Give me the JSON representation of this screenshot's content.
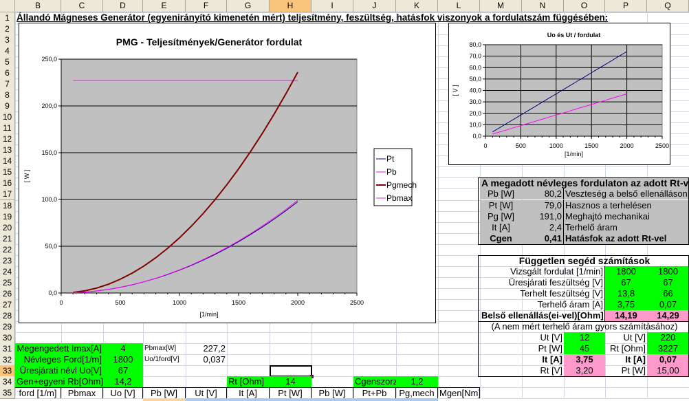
{
  "sheet": {
    "columns": [
      "B",
      "C",
      "D",
      "E",
      "F",
      "G",
      "H",
      "I",
      "J",
      "K",
      "L",
      "M",
      "N",
      "O",
      "P",
      "Q"
    ],
    "rows": [
      "1",
      "2",
      "3",
      "4",
      "5",
      "6",
      "7",
      "8",
      "9",
      "10",
      "11",
      "12",
      "13",
      "14",
      "15",
      "16",
      "17",
      "18",
      "19",
      "20",
      "21",
      "22",
      "23",
      "24",
      "25",
      "26",
      "27",
      "28",
      "29",
      "30",
      "31",
      "32",
      "33",
      "34",
      "35"
    ],
    "selected_column": "H",
    "selected_row": "33",
    "title": "Állandó Mágneses Generátor (egyenirányító kimenetén mért) teljesítmény, feszültség, hatásfok viszonyok a fordulatszám függésében:"
  },
  "colors": {
    "green": "#00ff00",
    "pink": "#ff99cc",
    "gray": "#c0c0c0",
    "plot_bg": "#c0c0c0",
    "selection": "#f9c47c"
  },
  "inputs": {
    "imax_label": "Megengedett Imax[A]",
    "imax": "4",
    "nevl_ford_label": "Névleges Ford[1/m]",
    "nevl_ford": "1800",
    "uo_label": "Üresjárati névl Uo[V]",
    "uo": "67",
    "rb_label": "Gen+egyeni Rb[Ohm]",
    "rb": "14,2",
    "pbmax_label": "Pbmax[W]",
    "pbmax": "227,2",
    "uo1_label": "Uo/1ford[V]",
    "uo1": "0,037",
    "rt_label": "Rt [Ohm]",
    "rt": "14",
    "cgen_label": "Cgenszorz",
    "cgen": "1,2"
  },
  "table_headers": [
    "ford [1/m]",
    "Pbmax",
    "Uo [V]",
    "Pb [W]",
    "Ut [V]",
    "It [A]",
    "Pt [W]",
    "Pb [W]",
    "Pt+Pb",
    "Pg,mech",
    "Mgen[Nm]"
  ],
  "summary": {
    "title": "A megadott névleges fordulaton az adott Rt-vel",
    "rows": [
      {
        "label": "Pb [W]",
        "value": "80,2",
        "desc": "Veszteség a belső ellenálláson"
      },
      {
        "label": "Pt [W]",
        "value": "79,0",
        "desc": "Hasznos a terhelésen"
      },
      {
        "label": "Pg [W]",
        "value": "191,0",
        "desc": "Meghajtó mechanikai"
      },
      {
        "label": "It [A]",
        "value": "2,4",
        "desc": "Terhelő áram"
      },
      {
        "label": "Cgen",
        "value": "0,41",
        "desc": "Hatásfok az adott Rt-vel"
      }
    ]
  },
  "aux": {
    "title": "Független segéd számítások",
    "rows": [
      {
        "label": "Vizsgált fordulat [1/min]",
        "v1": "1800",
        "v2": "1800"
      },
      {
        "label": "Üresjárati feszültség [V]",
        "v1": "67",
        "v2": "67"
      },
      {
        "label": "Terhelt feszültség [V]",
        "v1": "13,8",
        "v2": "66"
      },
      {
        "label": "Terhelő áram [A]",
        "v1": "3,75",
        "v2": "0,07"
      },
      {
        "label": "Belső ellenállás(ei-vel)[Ohm]",
        "v1": "14,19",
        "v2": "14,29"
      }
    ]
  },
  "quick": {
    "title": "(A nem mért terhelő áram gyors számításához)",
    "rows": [
      {
        "l1": "Ut [V]",
        "v1": "12",
        "l2": "Ut [V]",
        "v2": "220"
      },
      {
        "l1": "Pt [W]",
        "v1": "45",
        "l2": "Rt [Ohm]",
        "v2": "3227"
      },
      {
        "l1": "It [A]",
        "v1": "3,75",
        "l2": "It [A]",
        "v2": "0,07"
      },
      {
        "l1": "Rt [V]",
        "v1": "3,20",
        "l2": "Pt [W]",
        "v2": "15,00"
      }
    ]
  },
  "chart_data": [
    {
      "type": "line",
      "title": "PMG - Teljesítmények/Generátor fordulat",
      "xlabel": "[1/min]",
      "ylabel": "[ W ]",
      "xlim": [
        0,
        2500
      ],
      "ylim": [
        0,
        250
      ],
      "x_ticks": [
        "0",
        "500",
        "1000",
        "1500",
        "2000",
        "2500"
      ],
      "y_ticks": [
        "0,0",
        "50,0",
        "100,0",
        "150,0",
        "200,0",
        "250,0"
      ],
      "grid": "horizontal",
      "legend": "right",
      "x": [
        100,
        200,
        300,
        400,
        500,
        600,
        700,
        800,
        900,
        1000,
        1100,
        1200,
        1300,
        1400,
        1500,
        1600,
        1700,
        1800,
        1900,
        2000
      ],
      "series": [
        {
          "name": "Pt",
          "color": "#000080",
          "values": [
            0.24,
            0.98,
            2.19,
            3.9,
            6.1,
            8.78,
            11.95,
            15.6,
            19.75,
            24.38,
            29.5,
            35.11,
            41.21,
            47.79,
            54.86,
            62.42,
            70.47,
            79.0,
            88.02,
            97.53
          ]
        },
        {
          "name": "Pb",
          "color": "#ff00ff",
          "values": [
            0.25,
            0.99,
            2.23,
            3.96,
            6.19,
            8.91,
            12.13,
            15.84,
            20.05,
            24.75,
            29.95,
            35.64,
            41.83,
            48.52,
            55.69,
            63.37,
            71.54,
            80.2,
            89.36,
            99.01
          ]
        },
        {
          "name": "Pgmech",
          "color": "#800000",
          "values": [
            0.59,
            2.36,
            5.31,
            9.44,
            14.75,
            21.24,
            28.91,
            37.76,
            47.79,
            59.0,
            71.39,
            84.96,
            99.71,
            115.64,
            132.75,
            151.04,
            170.51,
            191.16,
            212.99,
            236.0
          ]
        },
        {
          "name": "Pbmax",
          "color": "#cc33cc",
          "values": [
            227.2,
            227.2,
            227.2,
            227.2,
            227.2,
            227.2,
            227.2,
            227.2,
            227.2,
            227.2,
            227.2,
            227.2,
            227.2,
            227.2,
            227.2,
            227.2,
            227.2,
            227.2,
            227.2,
            227.2
          ]
        }
      ]
    },
    {
      "type": "line",
      "title": "Uo és Ut / fordulat",
      "xlabel": "[1/min]",
      "ylabel": "[ V ]",
      "xlim": [
        0,
        2500
      ],
      "ylim": [
        0,
        80
      ],
      "x_ticks": [
        "0",
        "500",
        "1000",
        "1500",
        "2000",
        "2500"
      ],
      "y_ticks": [
        "0,0",
        "10,0",
        "20,0",
        "30,0",
        "40,0",
        "50,0",
        "60,0",
        "70,0",
        "80,0"
      ],
      "grid": "both",
      "legend": "none",
      "x": [
        100,
        200,
        300,
        400,
        500,
        600,
        700,
        800,
        900,
        1000,
        1100,
        1200,
        1300,
        1400,
        1500,
        1600,
        1700,
        1800,
        1900,
        2000
      ],
      "series": [
        {
          "color": "#000080",
          "values": [
            3.7,
            7.4,
            11.1,
            14.8,
            18.5,
            22.2,
            25.9,
            29.6,
            33.3,
            37.0,
            40.7,
            44.4,
            48.1,
            51.8,
            55.5,
            59.2,
            62.9,
            66.6,
            70.3,
            74.0
          ]
        },
        {
          "color": "#ff00ff",
          "values": [
            1.85,
            3.7,
            5.55,
            7.4,
            9.25,
            11.1,
            12.95,
            14.8,
            16.65,
            18.5,
            20.35,
            22.2,
            24.05,
            25.9,
            27.75,
            29.6,
            31.45,
            33.3,
            35.15,
            37.0
          ]
        }
      ]
    }
  ]
}
